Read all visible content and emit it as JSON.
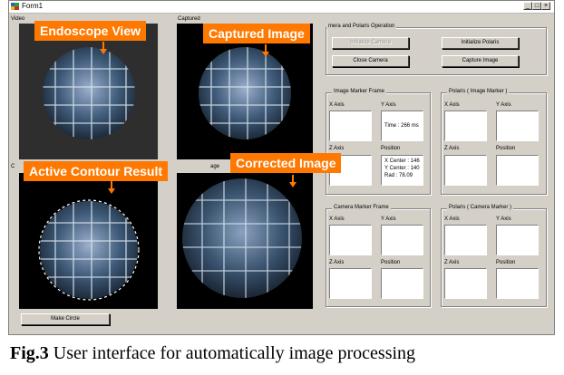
{
  "window": {
    "title": "Form1",
    "minimize": "_",
    "maximize": "□",
    "close": "×"
  },
  "panes": {
    "video": {
      "label": "Video"
    },
    "captured": {
      "label": "Captured"
    },
    "contour": {
      "label": "C"
    },
    "corrected": {
      "label": "age"
    }
  },
  "callouts": {
    "endoscope": "Endoscope View",
    "captured": "Captured Image",
    "contour": "Active Contour Result",
    "corrected": "Corrected Image"
  },
  "operation": {
    "title": "mera and Polaris Operation",
    "initialize_camera": "Initialize Camera",
    "initialize_polaris": "Initialize Polaris",
    "close_camera": "Close Camera",
    "capture_image": "Capture Image"
  },
  "image_marker": {
    "title": "Image Marker Frame",
    "x_axis": "X Axis",
    "y_axis": "Y Axis",
    "z_axis": "Z Axis",
    "position": "Position",
    "time": "Time : 266 ms",
    "x_center": "X Center : 146",
    "y_center": "Y Center : 140",
    "rad": "Rad : 78.09"
  },
  "polaris_image": {
    "title": "Polaris ( Image Marker )",
    "x_axis": "X Axis",
    "y_axis": "Y Axis",
    "z_axis": "Z Axis",
    "position": "Position"
  },
  "camera_marker": {
    "title": "Camera Marker Frame",
    "x_axis": "X Axis",
    "y_axis": "Y Axis",
    "z_axis": "Z Axis",
    "position": "Position"
  },
  "polaris_camera": {
    "title": "Polaris ( Camera Marker )",
    "x_axis": "X Axis",
    "y_axis": "Y Axis",
    "z_axis": "Z Axis",
    "position": "Position"
  },
  "make_circle": "Make Circle",
  "caption": {
    "label": "Fig.3",
    "text": " User interface for automatically image processing"
  },
  "colors": {
    "callout": "#ff7800",
    "window_bg": "#d4d0c8",
    "pane_bg": "#000000"
  }
}
